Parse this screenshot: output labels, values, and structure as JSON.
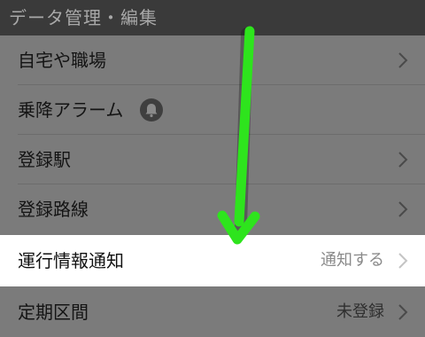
{
  "section": {
    "title": "データ管理・編集"
  },
  "rows": [
    {
      "label": "自宅や職場",
      "value": ""
    },
    {
      "label": "乗降アラーム",
      "value": ""
    },
    {
      "label": "登録駅",
      "value": ""
    },
    {
      "label": "登録路線",
      "value": ""
    },
    {
      "label": "運行情報通知",
      "value": "通知する"
    },
    {
      "label": "定期区間",
      "value": "未登録"
    }
  ],
  "icons": {
    "chevron": "chevron-right-icon",
    "bell": "bell-icon",
    "arrow": "arrow-down-icon"
  },
  "colors": {
    "arrow": "#29e11a",
    "header_bg": "#3a3a3a",
    "highlight_bg": "#ffffff",
    "dim_bg": "#7b7b7b"
  }
}
